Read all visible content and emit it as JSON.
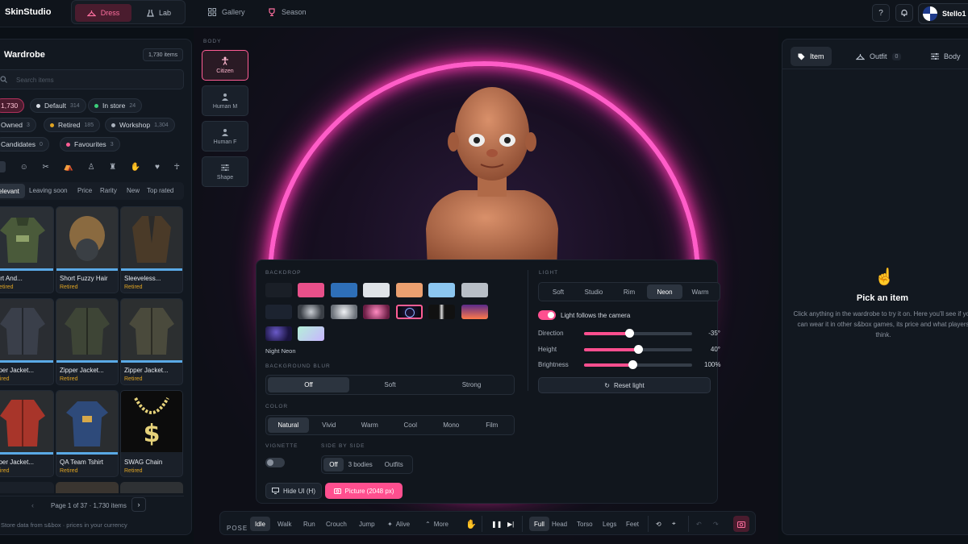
{
  "app": {
    "title": "SkinStudio"
  },
  "modes": [
    {
      "label": "Dress"
    },
    {
      "label": "Lab"
    }
  ],
  "nav": [
    {
      "label": "Gallery"
    },
    {
      "label": "Season"
    }
  ],
  "user": {
    "name": "Stello1"
  },
  "wardrobe": {
    "title": "Wardrobe",
    "count": "1,730 items",
    "search_placeholder": "Search items",
    "filters": [
      {
        "label": "1,730",
        "active": true
      },
      {
        "label": "Default",
        "count": "314",
        "dot": "#d9dee6"
      },
      {
        "label": "In store",
        "count": "24",
        "dot": "#3ccf7a"
      },
      {
        "label": "Owned",
        "count": "3"
      },
      {
        "label": "Retired",
        "count": "185",
        "dot": "#e0a422"
      },
      {
        "label": "Workshop",
        "count": "1,304",
        "dot": "#aab2bd"
      },
      {
        "label": "Candidates",
        "count": "0"
      },
      {
        "label": "Favourites",
        "count": "3",
        "dot": "#ff5d95"
      }
    ],
    "sort": [
      "elevant",
      "Leaving soon",
      "Price",
      "Rarity",
      "New",
      "Top rated"
    ],
    "items": [
      {
        "name": "hirt And...",
        "status": "Retired"
      },
      {
        "name": "Short Fuzzy Hair",
        "status": "Retired"
      },
      {
        "name": "Sleeveless...",
        "status": "Retired"
      },
      {
        "name": "pper Jacket...",
        "status": "etired"
      },
      {
        "name": "Zipper Jacket...",
        "status": "Retired"
      },
      {
        "name": "Zipper Jacket...",
        "status": "Retired"
      },
      {
        "name": "pper Jacket...",
        "status": "etired"
      },
      {
        "name": "QA Team Tshirt",
        "status": "Retired"
      },
      {
        "name": "SWAG Chain",
        "status": "Retired"
      }
    ],
    "pagination": "Page 1 of 37 · 1,730 items",
    "footer": "Store data from s&box · prices in your currency"
  },
  "body": {
    "label": "BODY",
    "options": [
      {
        "label": "Citizen"
      },
      {
        "label": "Human M"
      },
      {
        "label": "Human F"
      },
      {
        "label": "Shape"
      }
    ]
  },
  "settings": {
    "backdrop_label": "BACKDROP",
    "backdrop_selected": "Night Neon",
    "blur_label": "BACKGROUND BLUR",
    "blur": [
      "Off",
      "Soft",
      "Strong"
    ],
    "color_label": "COLOR",
    "color": [
      "Natural",
      "Vivid",
      "Warm",
      "Cool",
      "Mono",
      "Film"
    ],
    "vignette_label": "VIGNETTE",
    "side_label": "SIDE BY SIDE",
    "side": [
      "Off",
      "3 bodies",
      "Outfits"
    ],
    "hide_ui": "Hide UI (H)",
    "picture": "Picture (2048 px)",
    "light_label": "LIGHT",
    "light_modes": [
      "Soft",
      "Studio",
      "Rim",
      "Neon",
      "Warm"
    ],
    "follow_camera": "Light follows the camera",
    "direction": {
      "label": "Direction",
      "value": "-35°",
      "level": 0.42
    },
    "height": {
      "label": "Height",
      "value": "40°",
      "level": 0.5
    },
    "brightness": {
      "label": "Brightness",
      "value": "100%",
      "level": 0.45
    },
    "reset": "Reset light"
  },
  "right": {
    "tabs": [
      {
        "label": "Item"
      },
      {
        "label": "Outfit",
        "count": "0"
      },
      {
        "label": "Body"
      }
    ],
    "empty_title": "Pick an item",
    "empty_text": "Click anything in the wardrobe to try it on. Here you'll see if you can wear it in other s&box games, its price and what players think."
  },
  "bottom": {
    "pose_label": "POSE",
    "poses": [
      "Idle",
      "Walk",
      "Run",
      "Crouch",
      "Jump",
      "Alive",
      "More"
    ],
    "views": [
      "Full",
      "Head",
      "Torso",
      "Legs",
      "Feet"
    ]
  },
  "colors": {
    "accent": "#ff4f8f",
    "ring": "#ff5dc8",
    "retired": "#e0a422"
  }
}
